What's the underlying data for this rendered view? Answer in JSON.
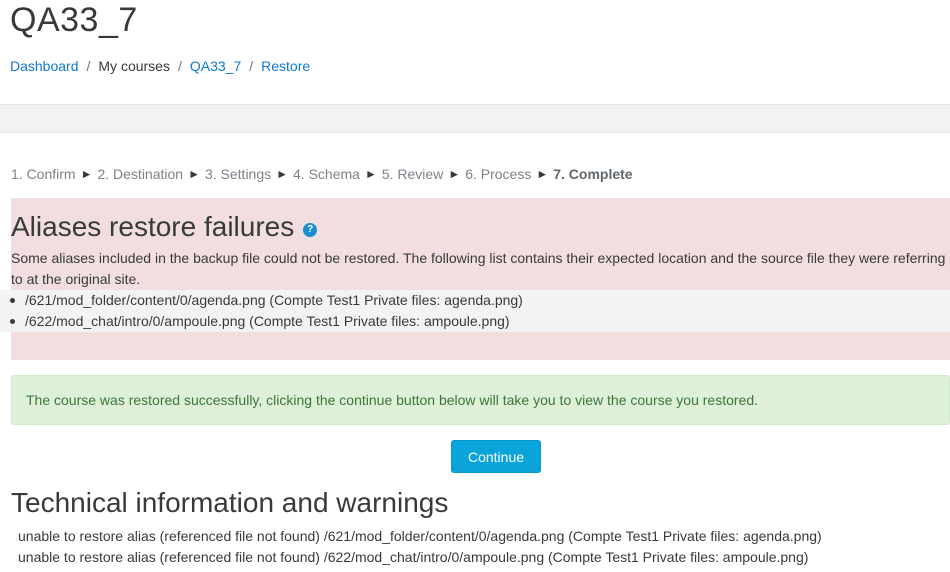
{
  "page": {
    "title": "QA33_7"
  },
  "breadcrumb": {
    "items": [
      {
        "label": "Dashboard",
        "link": true
      },
      {
        "label": "My courses",
        "link": false
      },
      {
        "label": "QA33_7",
        "link": true
      },
      {
        "label": "Restore",
        "link": true
      }
    ],
    "separator": "/"
  },
  "progress": {
    "steps": [
      "1. Confirm",
      "2. Destination",
      "3. Settings",
      "4. Schema",
      "5. Review",
      "6. Process",
      "7. Complete"
    ],
    "current_index": 6,
    "arrow": "►"
  },
  "aliases": {
    "title": "Aliases restore failures",
    "help_icon": "question-circle-icon",
    "description": "Some aliases included in the backup file could not be restored. The following list contains their expected location and the source file they were referring to at the original site.",
    "items": [
      "/621/mod_folder/content/0/agenda.png (Compte Test1 Private files: agenda.png)",
      "/622/mod_chat/intro/0/ampoule.png (Compte Test1 Private files: ampoule.png)"
    ]
  },
  "success": {
    "message": "The course was restored successfully, clicking the continue button below will take you to view the course you restored."
  },
  "continue_button": {
    "label": "Continue"
  },
  "technical": {
    "title": "Technical information and warnings",
    "lines": [
      "unable to restore alias (referenced file not found) /621/mod_folder/content/0/agenda.png (Compte Test1 Private files: agenda.png)",
      "unable to restore alias (referenced file not found) /622/mod_chat/intro/0/ampoule.png (Compte Test1 Private files: ampoule.png)"
    ]
  },
  "colors": {
    "link": "#1177d1",
    "error_bg": "#f2dede",
    "success_bg": "#dff0d8",
    "success_text": "#3c763d",
    "button_bg": "#0aa3da"
  }
}
